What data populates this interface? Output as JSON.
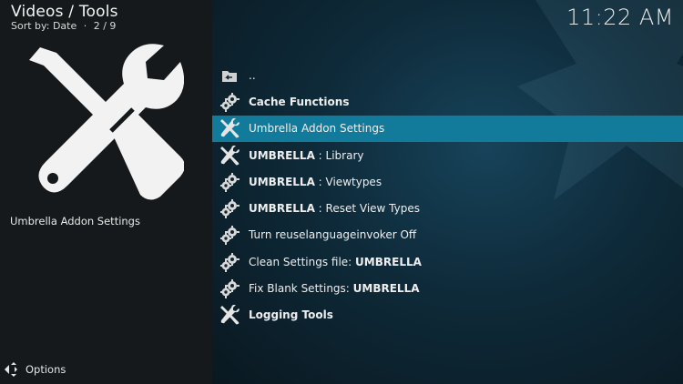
{
  "header": {
    "title": "Videos / Tools",
    "sort_label": "Sort by: Date",
    "separator": "·",
    "position": "2 / 9"
  },
  "clock": "11:22 AM",
  "selected_item_label": "Umbrella Addon Settings",
  "list": {
    "items": [
      {
        "icon": "folder-back-icon",
        "parts": [
          {
            "t": "..",
            "b": false
          }
        ]
      },
      {
        "icon": "gear-icon",
        "parts": [
          {
            "t": "Cache Functions",
            "b": true
          }
        ]
      },
      {
        "icon": "tools-icon",
        "parts": [
          {
            "t": "Umbrella Addon Settings",
            "b": false
          }
        ],
        "selected": true
      },
      {
        "icon": "tools-icon",
        "parts": [
          {
            "t": "UMBRELLA",
            "b": true
          },
          {
            "t": " : Library",
            "b": false
          }
        ]
      },
      {
        "icon": "gear-icon",
        "parts": [
          {
            "t": "UMBRELLA",
            "b": true
          },
          {
            "t": " : Viewtypes",
            "b": false
          }
        ]
      },
      {
        "icon": "gear-icon",
        "parts": [
          {
            "t": "UMBRELLA",
            "b": true
          },
          {
            "t": " : Reset View Types",
            "b": false
          }
        ]
      },
      {
        "icon": "gear-icon",
        "parts": [
          {
            "t": "Turn reuselanguageinvoker Off",
            "b": false
          }
        ]
      },
      {
        "icon": "gear-icon",
        "parts": [
          {
            "t": "Clean Settings file: ",
            "b": false
          },
          {
            "t": "UMBRELLA",
            "b": true
          }
        ]
      },
      {
        "icon": "gear-icon",
        "parts": [
          {
            "t": "Fix Blank Settings: ",
            "b": false
          },
          {
            "t": "UMBRELLA",
            "b": true
          }
        ]
      },
      {
        "icon": "tools-icon",
        "parts": [
          {
            "t": "Logging Tools",
            "b": true
          }
        ]
      }
    ]
  },
  "footer": {
    "options_label": "Options"
  },
  "colors": {
    "selection": "#127a9a",
    "left_panel": "#15191b"
  }
}
